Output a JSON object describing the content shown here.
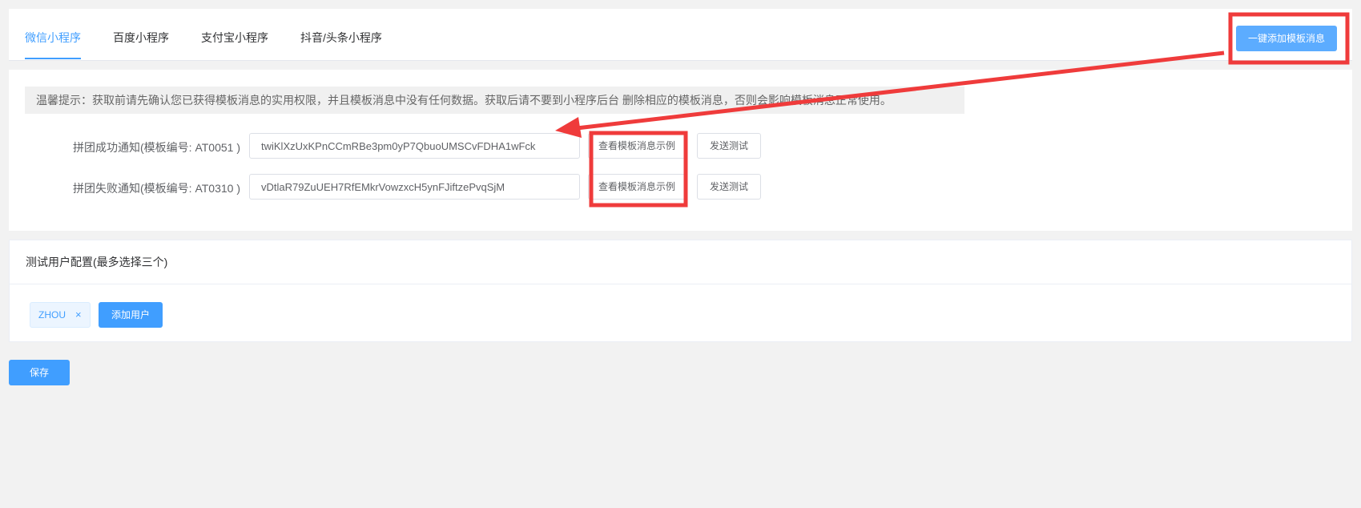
{
  "tabs": [
    {
      "label": "微信小程序",
      "active": true
    },
    {
      "label": "百度小程序",
      "active": false
    },
    {
      "label": "支付宝小程序",
      "active": false
    },
    {
      "label": "抖音/头条小程序",
      "active": false
    }
  ],
  "header": {
    "add_template_label": "一键添加模板消息"
  },
  "template_section": {
    "tip": "温馨提示：获取前请先确认您已获得模板消息的实用权限，并且模板消息中没有任何数据。获取后请不要到小程序后台 删除相应的模板消息，否则会影响模板消息正常使用。",
    "rows": [
      {
        "label": "拼团成功通知(模板编号: AT0051 )",
        "value": "twiKlXzUxKPnCCmRBe3pm0yP7QbuoUMSCvFDHA1wFck",
        "view_label": "查看模板消息示例",
        "test_label": "发送测试"
      },
      {
        "label": "拼团失败通知(模板编号: AT0310 )",
        "value": "vDtlaR79ZuUEH7RfEMkrVowzxcH5ynFJiftzePvqSjM",
        "view_label": "查看模板消息示例",
        "test_label": "发送测试"
      }
    ]
  },
  "test_users": {
    "title": "测试用户配置(最多选择三个)",
    "users": [
      {
        "name": "ZHOU",
        "close": "×"
      }
    ],
    "add_label": "添加用户"
  },
  "footer": {
    "save_label": "保存"
  },
  "colors": {
    "primary": "#409eff",
    "annotation": "#ef3b3b"
  }
}
